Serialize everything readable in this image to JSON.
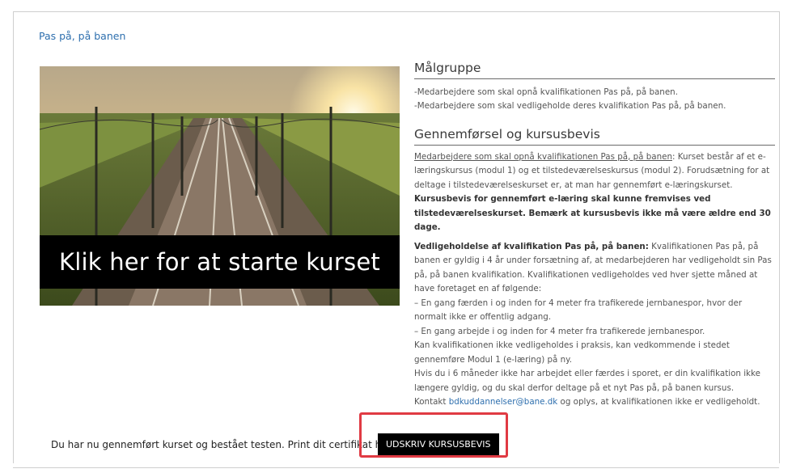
{
  "page": {
    "title": "Pas på, på banen"
  },
  "hero": {
    "banner_text": "Klik her for at starte kurset"
  },
  "target_group": {
    "heading": "Målgruppe",
    "items": [
      "-Medarbejdere som skal opnå kvalifikationen Pas på, på banen.",
      "-Medarbejdere som skal vedligeholde deres kvalifikation Pas på, på banen."
    ]
  },
  "completion": {
    "heading": "Gennemførsel og kursusbevis",
    "p1_link": "Medarbejdere som skal opnå kvalifikationen Pas på, på banen",
    "p1_text": ": Kurset består af et e-læringskursus (modul 1) og et tilstedeværelseskursus (modul 2). Forudsætning for at deltage i tilstedeværelseskurset er, at man har gennemført e-læringskurset.",
    "p1_bold": "Kursusbevis for gennemført e-læring skal kunne fremvises ved tilstedeværelseskurset. Bemærk at kursusbevis ikke må være ældre end 30 dage.",
    "p2_bold": "Vedligeholdelse af kvalifikation Pas på, på banen:",
    "p2_text": " Kvalifikationen Pas på, på banen er gyldig i 4 år under forsætning af, at medarbejderen har vedligeholdt sin Pas på, på banen kvalifikation. Kvalifikationen vedligeholdes ved hver sjette måned at have foretaget en af følgende:",
    "p2_item1": "– En gang færden i og inden for 4 meter fra trafikerede jernbanespor, hvor der normalt ikke er offentlig adgang.",
    "p2_item2": "– En gang arbejde i og inden for 4 meter fra trafikerede jernbanespor.",
    "p2_line3": "Kan kvalifikationen ikke vedligeholdes i praksis, kan vedkommende i stedet gennemføre Modul 1 (e-læring) på ny.",
    "p2_line4": "Hvis du i 6 måneder ikke har arbejdet eller færdes i sporet, er din kvalifikation ikke længere gyldig, og du skal derfor deltage på et nyt Pas på, på banen kursus.",
    "contact_prefix": "Kontakt ",
    "contact_email": "bdkuddannelser@bane.dk",
    "contact_suffix": " og oplys, at kvalifikationen ikke er vedligeholdt."
  },
  "footer": {
    "message": "Du har nu gennemført kurset og bestået testen. Print dit certifikat her:",
    "print_button": "UDSKRIV KURSUSBEVIS"
  },
  "colors": {
    "link": "#2e6fae",
    "highlight": "#e03a43",
    "button_bg": "#000000"
  }
}
